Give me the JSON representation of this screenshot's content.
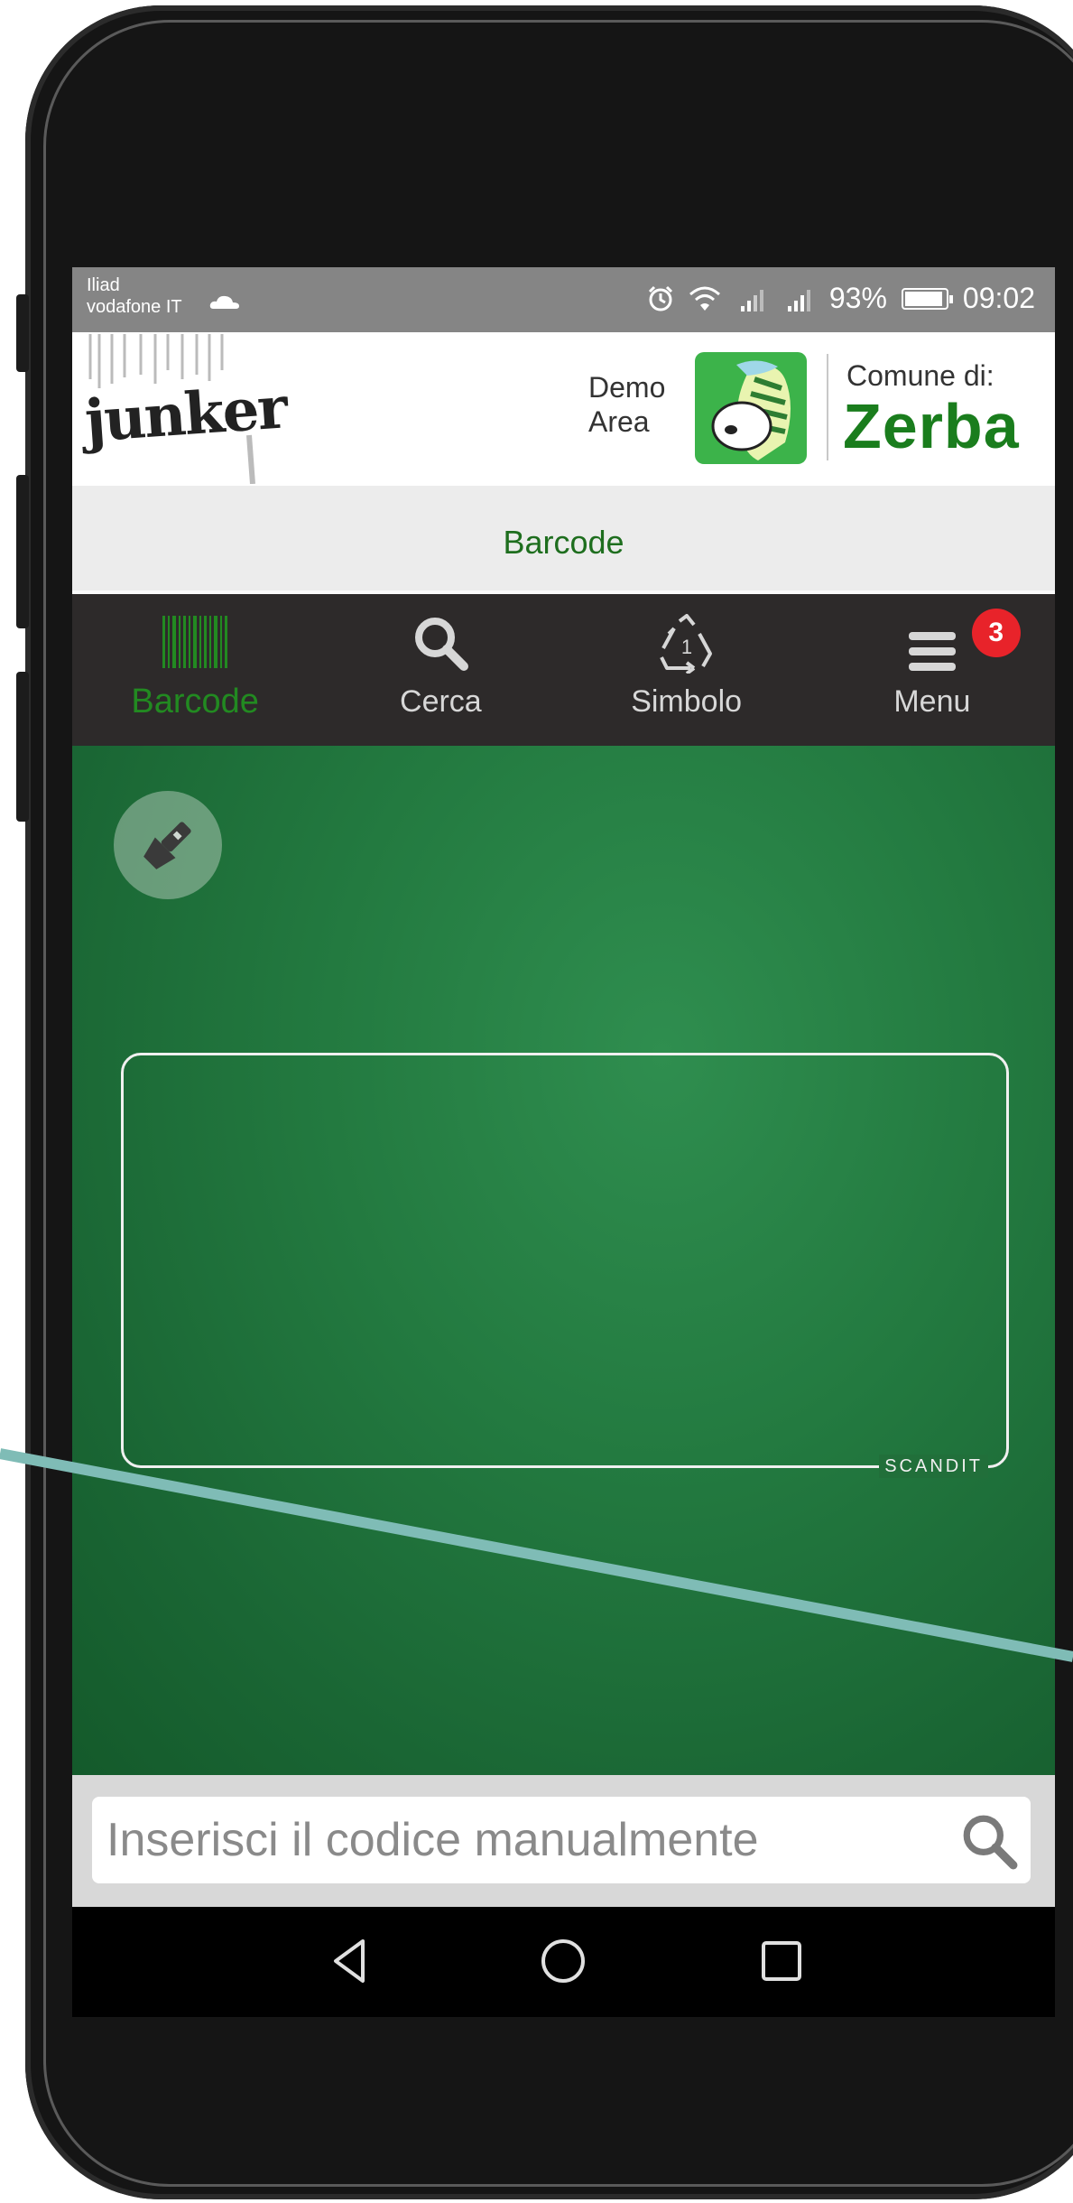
{
  "status_bar": {
    "carrier_line1": "Iliad",
    "carrier_line2": "vodafone IT",
    "battery": "93%",
    "battery_level": 0.93,
    "time": "09:02",
    "icons": [
      "cloud-icon",
      "alarm-icon",
      "wifi-icon",
      "signal-icon",
      "signal-icon",
      "battery-icon"
    ]
  },
  "header": {
    "logo_text": "junker",
    "demo_line1": "Demo",
    "demo_line2": "Area",
    "comune_label": "Comune di:",
    "comune_name": "Zerba"
  },
  "title_bar": {
    "title": "Barcode"
  },
  "tabs": [
    {
      "label": "Barcode",
      "icon": "barcode-icon",
      "active": true
    },
    {
      "label": "Cerca",
      "icon": "search-icon",
      "active": false
    },
    {
      "label": "Simbolo",
      "icon": "recycle-icon",
      "active": false
    },
    {
      "label": "Menu",
      "icon": "hamburger-icon",
      "active": false,
      "badge": "3"
    }
  ],
  "scanner": {
    "flash_icon": "flashlight-icon",
    "brand": "SCANDIT"
  },
  "manual_entry": {
    "placeholder": "Inserisci il codice manualmente",
    "value": "",
    "search_icon": "search-icon"
  },
  "nav_bar": {
    "icons": [
      "back-icon",
      "home-icon",
      "recents-icon"
    ]
  },
  "colors": {
    "accent_green": "#1a7d1d",
    "tab_bar": "#2d2a2a",
    "camera_green": "#237a40",
    "badge_red": "#e8232a",
    "annotation_teal": "#7fbcb6"
  }
}
